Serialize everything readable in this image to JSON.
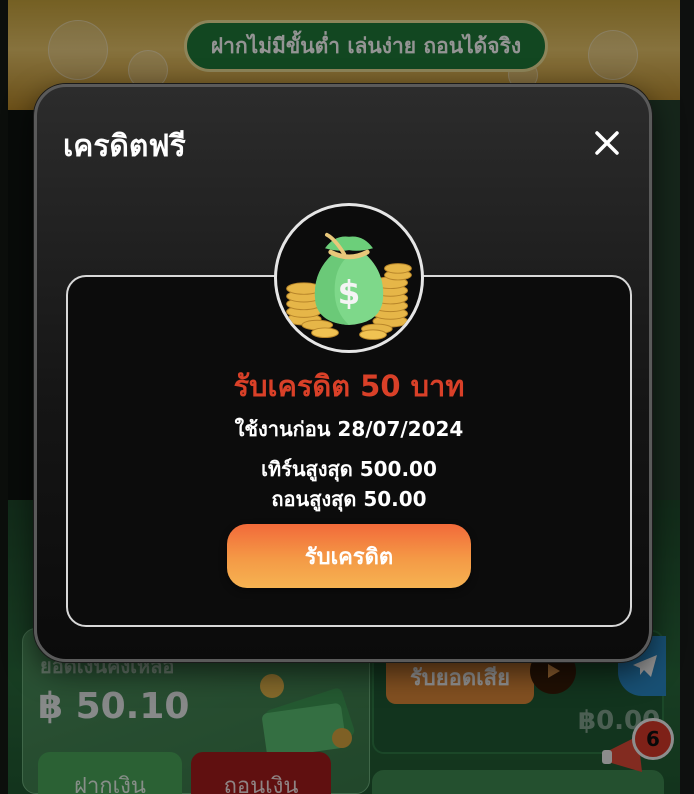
{
  "background": {
    "tagline": "ฝากไม่มีขั้นต่ำ เล่นง่าย ถอนได้จริง",
    "balance_label": "ยอดเงินคงเหลือ",
    "balance_amount": "฿ 50.10",
    "deposit_label": "ฝากเงิน",
    "withdraw_label": "ถอนเงิน",
    "loss_return_label": "รับยอดเสีย",
    "loss_return_amount": "฿0.00",
    "notification_count": "6"
  },
  "modal": {
    "title": "เครดิตฟรี",
    "close_icon": "close-icon",
    "image_icon": "money-bag-icon",
    "credit_amount": "รับเครดิต 50 บาท",
    "expiry": "ใช้งานก่อน 28/07/2024",
    "max_turnover": "เทิร์นสูงสุด 500.00",
    "max_withdraw": "ถอนสูงสุด 50.00",
    "claim_button": "รับเครดิต"
  },
  "colors": {
    "accent_red": "#d94028",
    "button_orange": "#f49a46",
    "brand_green": "#1f7a3a"
  }
}
